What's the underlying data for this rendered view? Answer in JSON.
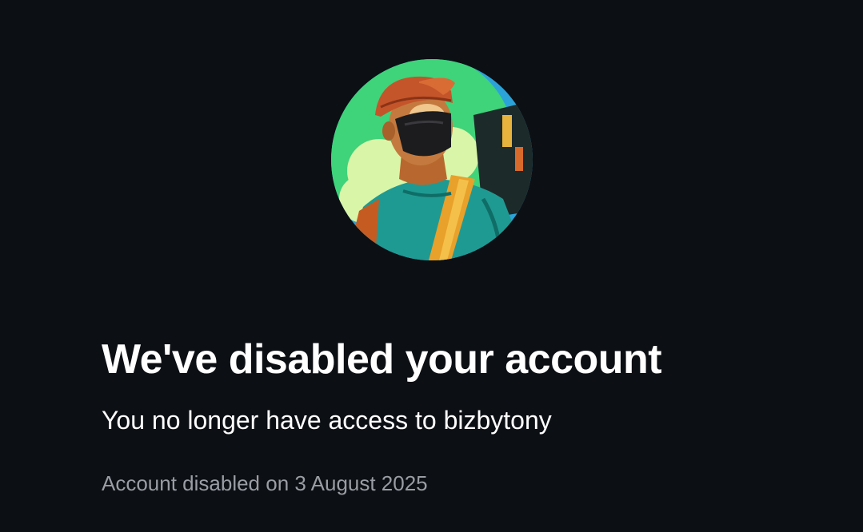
{
  "notice": {
    "title": "We've disabled your account",
    "subtitle": "You no longer have access to bizbytony",
    "disabled_date_text": "Account disabled on 3 August 2025"
  },
  "avatar": {
    "icon": "profile-illustration"
  },
  "colors": {
    "background": "#0c0f14",
    "title": "#ffffff",
    "subtitle": "#ffffff",
    "meta": "#9a9da3"
  }
}
